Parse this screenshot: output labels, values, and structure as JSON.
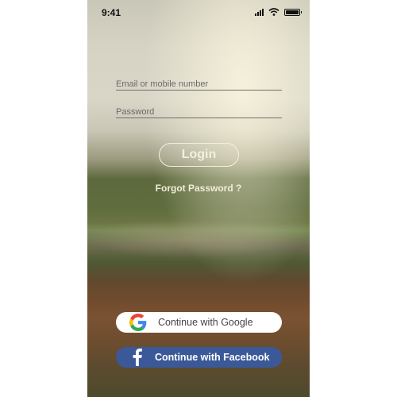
{
  "status_bar": {
    "time": "9:41"
  },
  "login_form": {
    "email_placeholder": "Email or mobile number",
    "password_placeholder": "Password",
    "login_label": "Login",
    "forgot_password_label": "Forgot Password ?"
  },
  "social": {
    "google_label": "Continue with Google",
    "facebook_label": "Continue with Facebook"
  },
  "colors": {
    "facebook_blue": "#3b5998",
    "google_button_bg": "#ffffff"
  },
  "icons": {
    "google": "google-icon",
    "facebook": "facebook-icon"
  }
}
